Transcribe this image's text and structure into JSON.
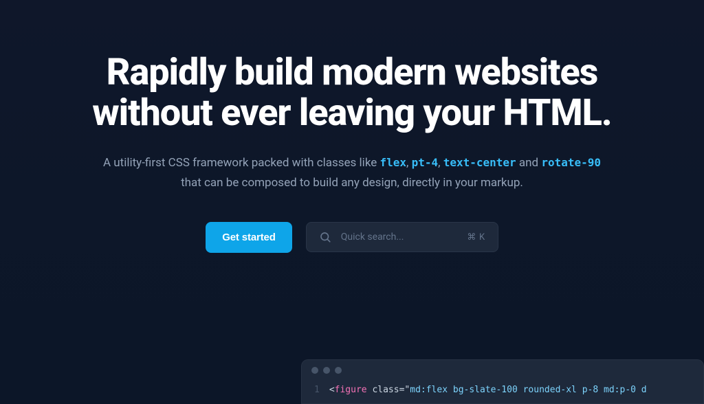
{
  "hero": {
    "headline_line1": "Rapidly build modern websites",
    "headline_line2": "without ever leaving your HTML.",
    "sub_prefix": "A utility-first CSS framework packed with classes like ",
    "sub_class1": "flex",
    "sub_sep1": ", ",
    "sub_class2": "pt-4",
    "sub_sep2": ", ",
    "sub_class3": "text-center",
    "sub_and": " and ",
    "sub_class4": "rotate-90",
    "sub_suffix": " that can be composed to build any design, directly in your markup."
  },
  "cta": {
    "get_started_label": "Get started"
  },
  "search": {
    "placeholder": "Quick search...",
    "shortcut": "⌘ K"
  },
  "editor": {
    "line_number": "1",
    "code": {
      "open_angle": "<",
      "tag": "figure",
      "space": " ",
      "attr": "class",
      "equals": "=",
      "quote_open": "\"",
      "class_value": "md:flex bg-slate-100 rounded-xl p-8 md:p-0 d",
      "quote_close": ""
    }
  }
}
